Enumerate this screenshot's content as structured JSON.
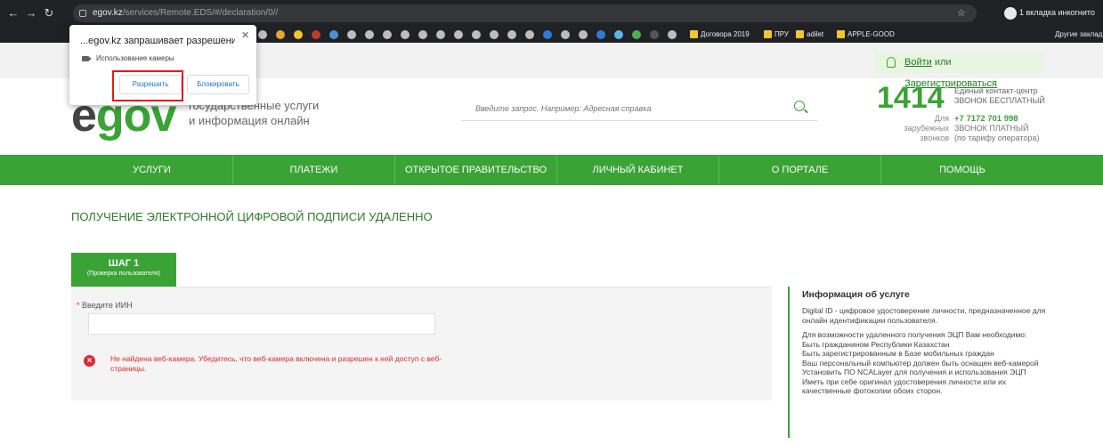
{
  "browser": {
    "url_host": "egov.kz",
    "url_path": "/services/Remote.EDS/#/declaration/0//",
    "incognito_label": "1 вкладка инкогнито",
    "bookmarks": [
      "Договора 2019",
      "ПРУ",
      "adilet",
      "APPLE-GOOD"
    ],
    "other_bookmarks": "Другие заклад"
  },
  "permission": {
    "title": "...egov.kz запрашивает разрешение на:",
    "camera": "Использование камеры",
    "allow": "Разрешить",
    "block": "Блокировать"
  },
  "header": {
    "login": "Войти",
    "or": "или",
    "register": "Зарегистрироваться",
    "logo_e": "e",
    "logo_gov": "gov",
    "tagline_1": "государственные услуги",
    "tagline_2": "и информация онлайн",
    "search_placeholder": "Введите запрос. Например: Адресная справка",
    "phone_short": "1414",
    "contact_center": "Единый контакт-центр",
    "free_call": "ЗВОНОК БЕСПЛАТНЫЙ",
    "foreign_1": "Для зарубежных",
    "foreign_2": "звонков",
    "phone_long": "+7 7172 701 998",
    "paid_call": "ЗВОНОК ПЛАТНЫЙ",
    "tariff": "(по тарифу оператора)"
  },
  "nav": [
    "УСЛУГИ",
    "ПЛАТЕЖИ",
    "ОТКРЫТОЕ ПРАВИТЕЛЬСТВО",
    "ЛИЧНЫЙ КАБИНЕТ",
    "О ПОРТАЛЕ",
    "ПОМОЩЬ"
  ],
  "main": {
    "page_title": "ПОЛУЧЕНИЕ ЭЛЕКТРОННОЙ ЦИФРОВОЙ ПОДПИСИ УДАЛЕННО",
    "step_title": "ШАГ 1",
    "step_sub": "(Проверка пользователя)",
    "iin_label": "Введите ИИН",
    "iin_value": "",
    "error_text": "Не найдена веб-камера. Убедитесь, что веб-камера включена и разрешен к ней доступ с веб-страницы."
  },
  "info": {
    "title": "Информация об услуге",
    "p1": "Digital ID - цифровое удостоверение личности, предназначенное для онлайн идентификации пользователя.",
    "p2": "Для возможности удаленного получения ЭЦП Вам необходимо:",
    "l1": "Быть гражданином Республики Казахстан",
    "l2": "Быть зарегистрированным в Базе мобильных граждан",
    "l3": "Ваш персональный компьютер должен быть оснащен веб-камерой",
    "l4": "Установить ПО NCALayer для получения и использования ЭЦП",
    "l5": "Иметь при себе оригинал удостоверения личности или их качественные фотокопии обоих сторон."
  },
  "colors": {
    "brand_green": "#3aa335",
    "error_red": "#e4262e",
    "highlight_red": "#e21b1b"
  }
}
